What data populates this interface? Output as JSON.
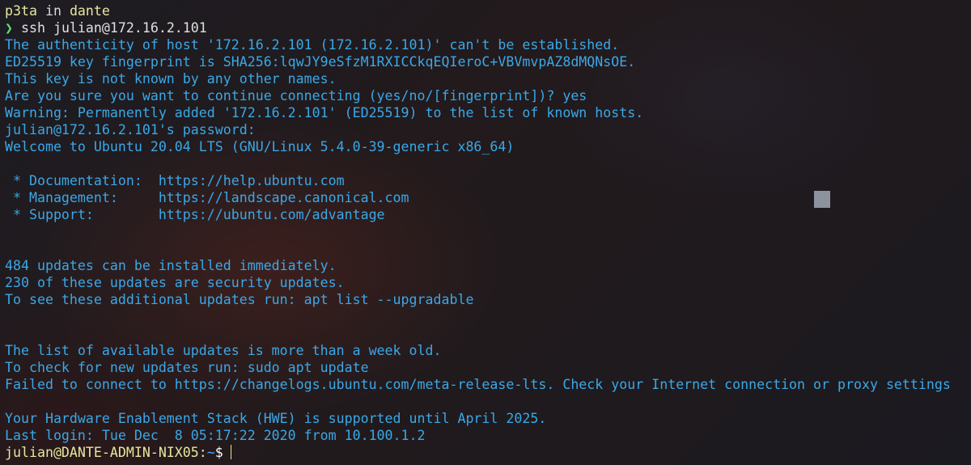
{
  "header": {
    "user": "p3ta",
    "in_label": " in ",
    "dir": "dante"
  },
  "command_prompt": {
    "symbol": "❯",
    "command": " ssh julian@172.16.2.101"
  },
  "output_lines": [
    "The authenticity of host '172.16.2.101 (172.16.2.101)' can't be established.",
    "ED25519 key fingerprint is SHA256:lqwJY9eSfzM1RXICCkqEQIeroC+VBVmvpAZ8dMQNsOE.",
    "This key is not known by any other names.",
    "Are you sure you want to continue connecting (yes/no/[fingerprint])? yes",
    "Warning: Permanently added '172.16.2.101' (ED25519) to the list of known hosts.",
    "julian@172.16.2.101's password:",
    "Welcome to Ubuntu 20.04 LTS (GNU/Linux 5.4.0-39-generic x86_64)",
    "",
    " * Documentation:  https://help.ubuntu.com",
    " * Management:     https://landscape.canonical.com",
    " * Support:        https://ubuntu.com/advantage",
    "",
    "",
    "484 updates can be installed immediately.",
    "230 of these updates are security updates.",
    "To see these additional updates run: apt list --upgradable",
    "",
    "",
    "The list of available updates is more than a week old.",
    "To check for new updates run: sudo apt update",
    "Failed to connect to https://changelogs.ubuntu.com/meta-release-lts. Check your Internet connection or proxy settings",
    "",
    "Your Hardware Enablement Stack (HWE) is supported until April 2025.",
    "Last login: Tue Dec  8 05:17:22 2020 from 10.100.1.2"
  ],
  "remote_prompt": {
    "user_host": "julian@DANTE-ADMIN-NIX05",
    "separator": ":",
    "path": "~",
    "dollar": "$"
  }
}
